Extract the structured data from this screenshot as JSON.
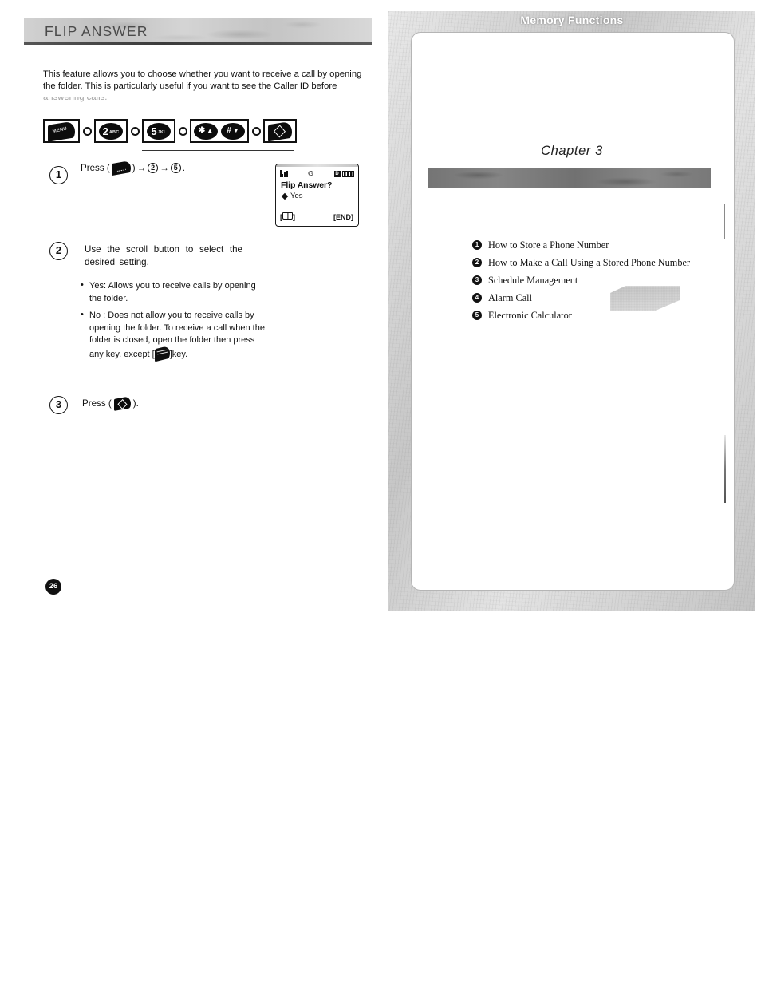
{
  "left_page": {
    "header_title": "FLIP ANSWER",
    "intro": "This feature allows you to choose whether you want to receive a call by opening the folder. This is particularly useful if you want to see the Caller ID before",
    "intro_faded": "answering calls.",
    "key_sequence": [
      {
        "type": "menu-key",
        "label": "MENU"
      },
      {
        "type": "separator",
        "label": "○"
      },
      {
        "type": "number-key",
        "digit": "2",
        "letters": "ABC"
      },
      {
        "type": "separator",
        "label": "○"
      },
      {
        "type": "number-key",
        "digit": "5",
        "letters": "JKL"
      },
      {
        "type": "separator",
        "label": "○"
      },
      {
        "type": "scroll-keys",
        "up": "✱▲",
        "down": "#▼"
      },
      {
        "type": "separator",
        "label": "○"
      },
      {
        "type": "end-key",
        "label": "END"
      }
    ],
    "steps": [
      {
        "number": "1",
        "prefix": "Press (",
        "icon": "menu-key-icon",
        "suffix": ")",
        "sequence": [
          "2",
          "5"
        ],
        "arrow": "→",
        "period": "."
      },
      {
        "number": "2",
        "text": "Use the scroll button to select the desired setting."
      },
      {
        "number": "3",
        "prefix": "Press (",
        "icon": "end-key-icon",
        "suffix": ")."
      }
    ],
    "bullets": [
      {
        "label": "Yes",
        "separator": ": ",
        "text": "Allows you to receive calls by opening the folder."
      },
      {
        "label": "No ",
        "separator": ": ",
        "text_before": "Does not allow you to receive calls by opening the folder. To receive a call when the folder is closed, open the folder then press any key. except [",
        "icon": "send-key-icon",
        "text_after": "]key."
      }
    ],
    "lcd": {
      "status": {
        "signal": "signal-bars-icon",
        "middle": "roaming-icon",
        "mode_box": "D",
        "battery": "battery-icon"
      },
      "question": "Flip Answer?",
      "selection_marker": "◆",
      "selection": "Yes",
      "softkey_left": "[  ]",
      "softkey_left_icon": "book-icon",
      "softkey_right": "[END]"
    },
    "page_number": "26"
  },
  "right_page": {
    "chapter_label": "Chapter 3",
    "chapter_title": "Memory Functions",
    "toc": [
      {
        "number": "1",
        "label": "How to Store a Phone Number"
      },
      {
        "number": "2",
        "label": "How to Make a Call Using a Stored Phone Number"
      },
      {
        "number": "3",
        "label": "Schedule Management"
      },
      {
        "number": "4",
        "label": "Alarm Call"
      },
      {
        "number": "5",
        "label": "Electronic Calculator"
      }
    ]
  }
}
